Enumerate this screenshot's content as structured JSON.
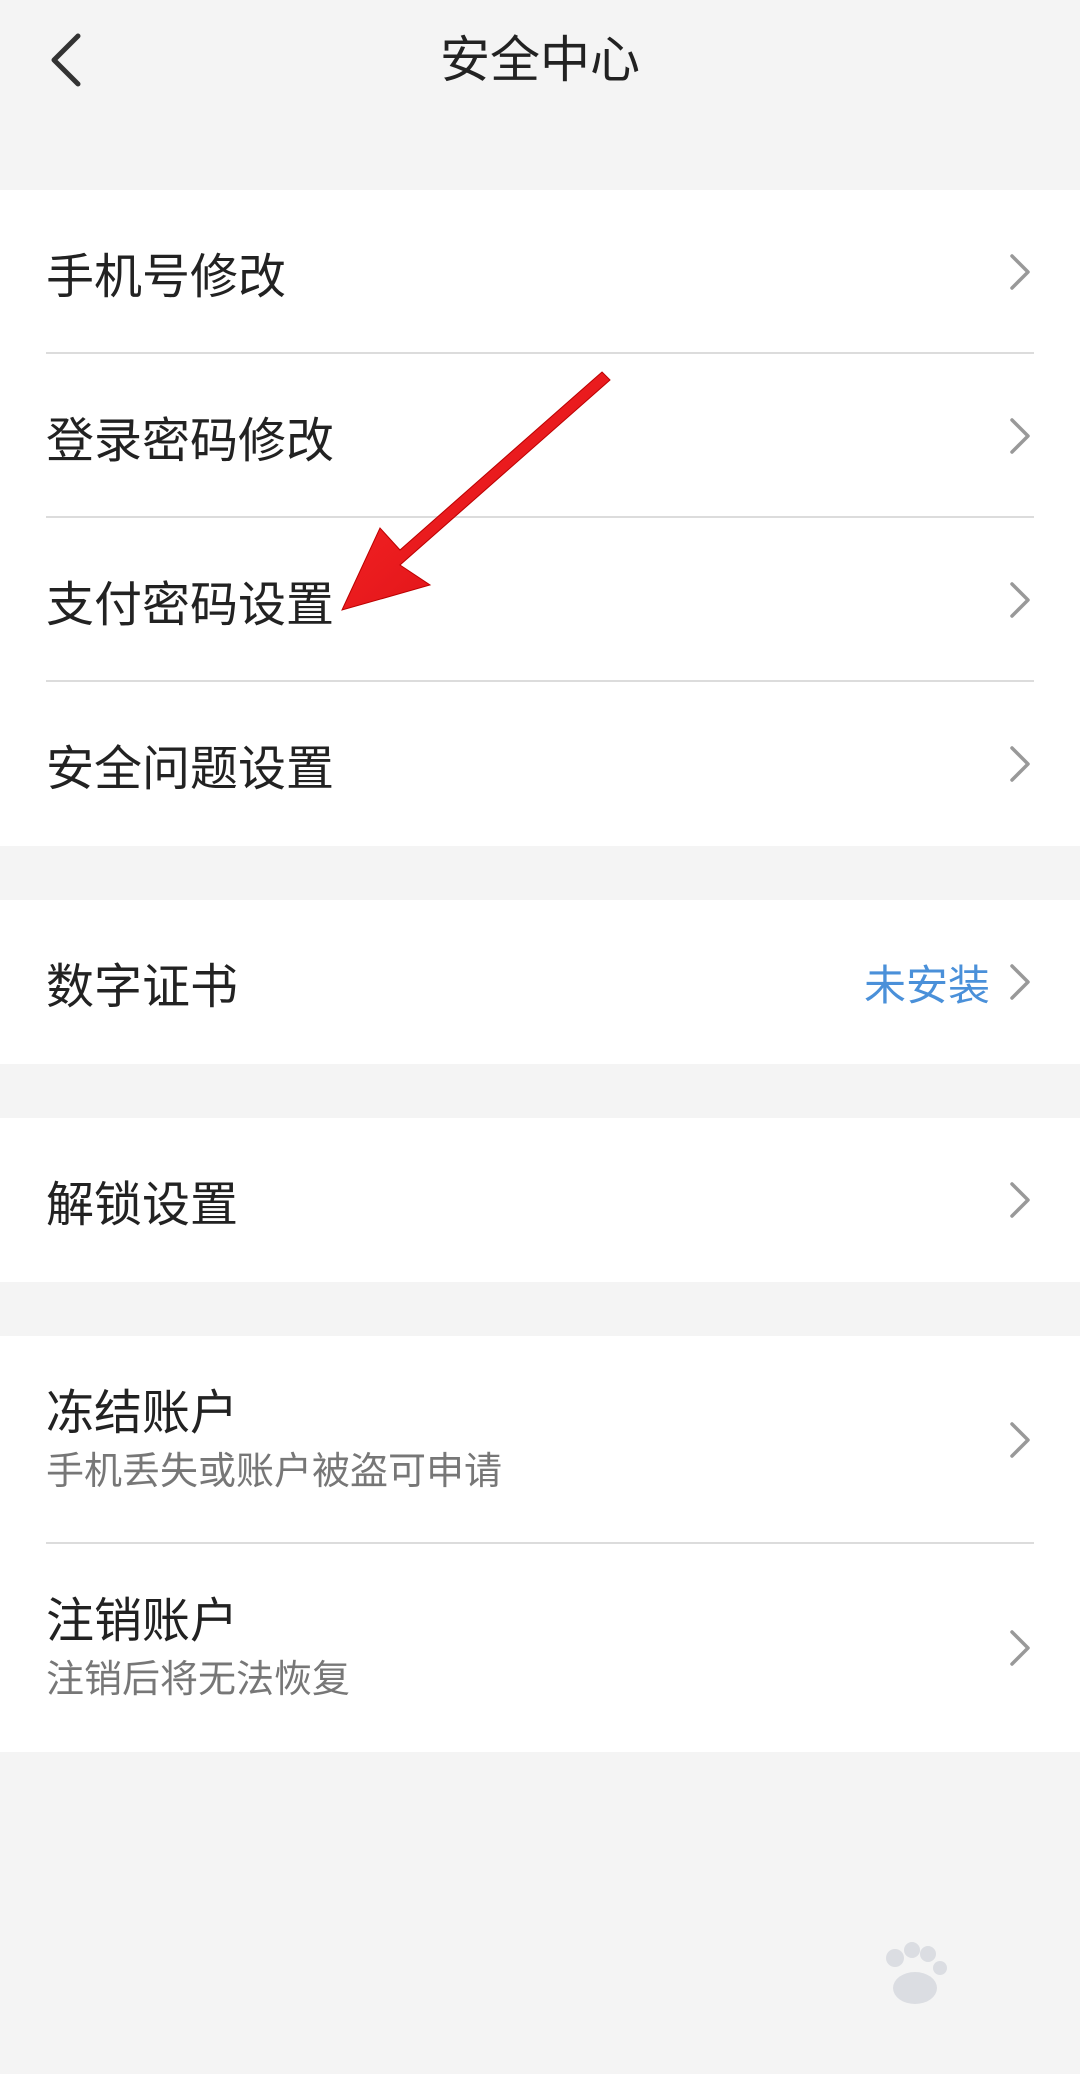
{
  "header": {
    "title": "安全中心"
  },
  "groups": [
    {
      "items": [
        {
          "label": "手机号修改"
        },
        {
          "label": "登录密码修改"
        },
        {
          "label": "支付密码设置"
        },
        {
          "label": "安全问题设置"
        }
      ]
    },
    {
      "items": [
        {
          "label": "数字证书",
          "status": "未安装"
        }
      ]
    },
    {
      "items": [
        {
          "label": "解锁设置"
        }
      ]
    },
    {
      "items": [
        {
          "label": "冻结账户",
          "sub": "手机丢失或账户被盗可申请"
        },
        {
          "label": "注销账户",
          "sub": "注销后将无法恢复"
        }
      ]
    }
  ],
  "colors": {
    "background": "#f4f4f4",
    "card": "#ffffff",
    "status_blue": "#4a90d9",
    "annotation_red": "#e8141c"
  },
  "icons": [
    "back-arrow-icon",
    "chevron-right-icon",
    "annotation-arrow-icon"
  ]
}
